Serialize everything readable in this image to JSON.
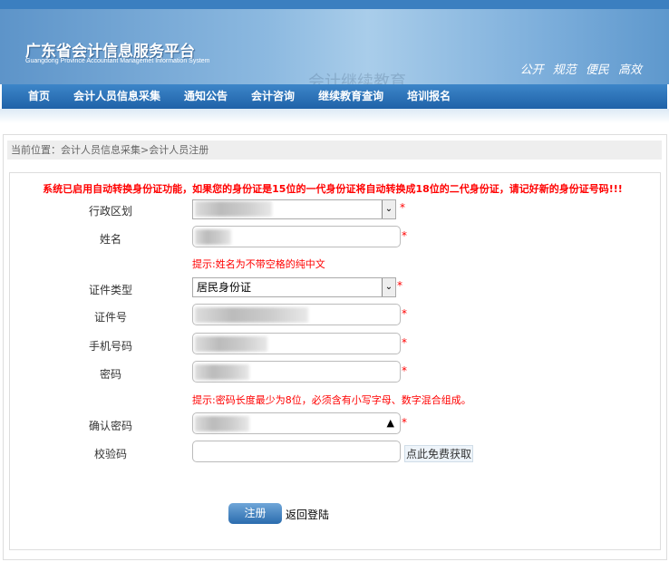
{
  "header": {
    "title": "广东省会计信息服务平台",
    "subtitle": "Guangdong Province Accountant Managemet Information System",
    "banner_art": "会计继续教育",
    "slogan": "公开 规范 便民 高效"
  },
  "nav": [
    "首页",
    "会计人员信息采集",
    "通知公告",
    "会计咨询",
    "继续教育查询",
    "培训报名"
  ],
  "breadcrumb": "当前位置：会计人员信息采集>会计人员注册",
  "notice": "系统已启用自动转换身份证功能，如果您的身份证是15位的一代身份证将自动转换成18位的二代身份证，请记好新的身份证号码!!!",
  "form": {
    "region_label": "行政区划",
    "name_label": "姓名",
    "name_hint": "提示:姓名为不带空格的纯中文",
    "id_type_label": "证件类型",
    "id_type_value": "居民身份证",
    "id_number_label": "证件号",
    "phone_label": "手机号码",
    "password_label": "密码",
    "password_hint": "提示:密码长度最少为8位，必须含有小写字母、数字混合组成。",
    "confirm_label": "确认密码",
    "captcha_label": "校验码",
    "captcha_value": "",
    "get_code": "点此免费获取",
    "required": "*",
    "submit": "注册",
    "back": "返回登陆"
  }
}
